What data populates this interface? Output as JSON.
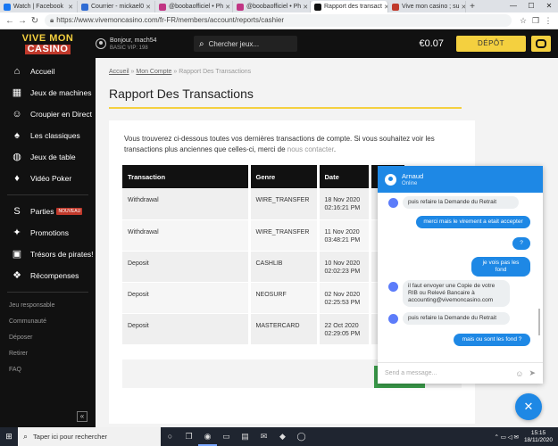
{
  "browser": {
    "tabs": [
      {
        "label": "Watch | Facebook",
        "color": "#1877f2",
        "active": false
      },
      {
        "label": "Courrier - mickael0",
        "color": "#2f6cd4",
        "active": false
      },
      {
        "label": "@boobaofficiel • Ph",
        "color": "#c13584",
        "active": false
      },
      {
        "label": "@boobaofficiel • Ph",
        "color": "#c13584",
        "active": false
      },
      {
        "label": "Rapport des transact",
        "color": "#111111",
        "active": true
      },
      {
        "label": "Vive mon casino ; su",
        "color": "#c0392b",
        "active": false
      }
    ],
    "new_tab": "+",
    "url": "https://www.vivemoncasino.com/fr-FR/members/account/reports/cashier"
  },
  "header": {
    "logo_line1": "VIVE MON",
    "logo_line2": "CASINO",
    "greeting": "Bonjour, mach54",
    "vip": "BASIC VIP: 198",
    "search_placeholder": "Chercher jeux...",
    "balance": "€0.07",
    "deposit_label": "DÉPÔT",
    "accent": "#f4d03f"
  },
  "sidebar": {
    "items": [
      {
        "label": "Accueil",
        "icon": "home-icon",
        "glyph": "⌂"
      },
      {
        "label": "Jeux de machines",
        "icon": "slot-machine-icon",
        "glyph": "▦"
      },
      {
        "label": "Croupier en Direct",
        "icon": "dealer-icon",
        "glyph": "☺"
      },
      {
        "label": "Les classiques",
        "icon": "cards-icon",
        "glyph": "♠"
      },
      {
        "label": "Jeux de table",
        "icon": "table-icon",
        "glyph": "◍"
      },
      {
        "label": "Vidéo Poker",
        "icon": "poker-icon",
        "glyph": "♦"
      }
    ],
    "items2": [
      {
        "label": "Parties",
        "icon": "parties-icon",
        "glyph": "S",
        "badge": "NOUVEAU"
      },
      {
        "label": "Promotions",
        "icon": "promotions-icon",
        "glyph": "✦"
      },
      {
        "label": "Trésors de pirates!",
        "icon": "treasure-icon",
        "glyph": "▣"
      },
      {
        "label": "Récompenses",
        "icon": "rewards-icon",
        "glyph": "❖"
      }
    ],
    "links": [
      "Jeu responsable",
      "Communauté",
      "Déposer",
      "Retirer",
      "FAQ"
    ],
    "collapse": "«"
  },
  "main": {
    "breadcrumb": {
      "home": "Accueil",
      "account": "Mon Compte",
      "current": "Rapport Des Transactions",
      "sep": " » "
    },
    "title": "Rapport Des Transactions",
    "intro": "Vous trouverez ci-dessous toutes vos dernières transactions de compte. Si vous souhaitez voir les transactions plus anciennes que celles-ci, merci de ",
    "intro_link": "nous contacter",
    "intro_end": ".",
    "columns": [
      "Transaction",
      "Genre",
      "Date",
      ""
    ],
    "rows": [
      {
        "transaction": "Withdrawal",
        "genre": "WIRE_TRANSFER",
        "date": "18 Nov 2020",
        "time": "02:16:21 PM"
      },
      {
        "transaction": "Withdrawal",
        "genre": "WIRE_TRANSFER",
        "date": "11 Nov 2020",
        "time": "03:48:21 PM"
      },
      {
        "transaction": "Deposit",
        "genre": "CASHLIB",
        "date": "10 Nov 2020",
        "time": "02:02:23 PM"
      },
      {
        "transaction": "Deposit",
        "genre": "NEOSURF",
        "date": "02 Nov 2020",
        "time": "02:25:53 PM"
      },
      {
        "transaction": "Deposit",
        "genre": "MASTERCARD",
        "date": "22 Oct 2020",
        "time": "02:29:05 PM"
      }
    ]
  },
  "chat": {
    "agent": "Arnaud",
    "status": "Online",
    "messages": [
      {
        "dir": "in",
        "text": "puis refaire la Demande du Retrait"
      },
      {
        "dir": "out",
        "text": "merci mais le virement a etait accepter"
      },
      {
        "dir": "out",
        "text": "?"
      },
      {
        "dir": "out",
        "text": "je vois pas les fond"
      },
      {
        "dir": "in",
        "text": "il faut envoyer une Copie de votre RIB ou Relevé Bancaire à accounting@vivemoncasino.com"
      },
      {
        "dir": "in",
        "text": "puis refaire la Demande du Retrait"
      },
      {
        "dir": "out",
        "text": "mais ou sont les fond ?"
      }
    ],
    "input_placeholder": "Send a message...",
    "fab": "✕",
    "color": "#1e88e5"
  },
  "taskbar": {
    "search": "Taper ici pour rechercher",
    "time": "15:15",
    "date": "18/11/2020"
  }
}
